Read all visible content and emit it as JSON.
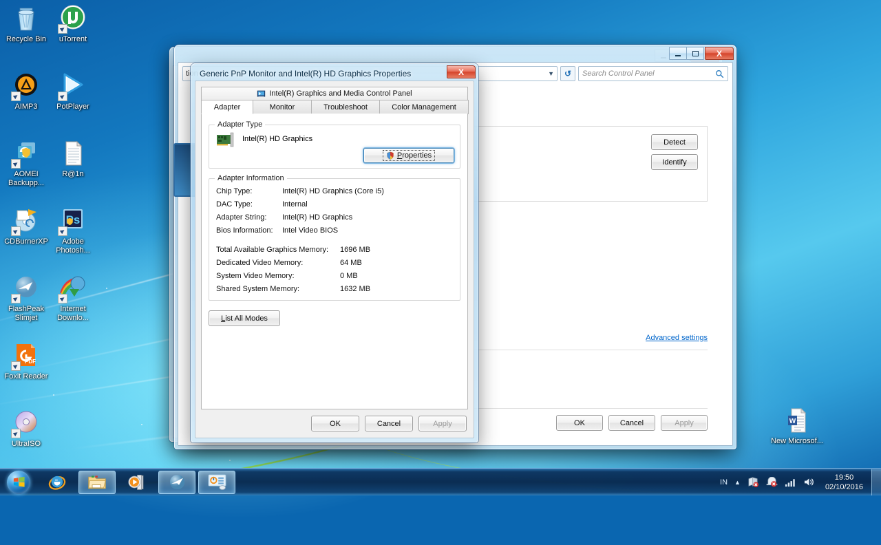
{
  "desktop": {
    "icons": [
      {
        "label": "Recycle Bin",
        "icon": "recycle-bin-icon",
        "shortcut": false
      },
      {
        "label": "uTorrent",
        "icon": "utorrent-icon",
        "shortcut": true
      },
      {
        "label": "AIMP3",
        "icon": "aimp3-icon",
        "shortcut": true
      },
      {
        "label": "PotPlayer",
        "icon": "potplayer-icon",
        "shortcut": true
      },
      {
        "label": "AOMEI Backupp...",
        "icon": "aomei-backupper-icon",
        "shortcut": true
      },
      {
        "label": "R@1n",
        "icon": "text-document-icon",
        "shortcut": false
      },
      {
        "label": "CDBurnerXP",
        "icon": "cdburnerxp-icon",
        "shortcut": true
      },
      {
        "label": "Adobe Photosh...",
        "icon": "adobe-photoshop-icon",
        "shortcut": true
      },
      {
        "label": "FlashPeak Slimjet",
        "icon": "slimjet-icon",
        "shortcut": true
      },
      {
        "label": "Internet Downlo...",
        "icon": "internet-download-manager-icon",
        "shortcut": true
      },
      {
        "label": "Foxit Reader",
        "icon": "foxit-reader-icon",
        "shortcut": true
      },
      {
        "label": "UltraISO",
        "icon": "ultraiso-icon",
        "shortcut": true
      },
      {
        "label": "New Microsof...",
        "icon": "word-document-icon",
        "shortcut": false
      }
    ]
  },
  "control_panel_window": {
    "title": "",
    "address_value": "tion",
    "search_placeholder": "Search Control Panel",
    "search_icon": "search-icon",
    "refresh_icon": "refresh-icon",
    "dropdown_icon": "chevron-down-icon",
    "minimize_label": "–",
    "maximize_label": "□",
    "close_label": "X",
    "detect_label": "Detect",
    "identify_label": "Identify",
    "advanced_settings_label": "Advanced settings",
    "ok_label": "OK",
    "cancel_label": "Cancel",
    "apply_label": "Apply"
  },
  "back_window": {
    "minimize_label": "–",
    "maximize_label": "□",
    "close_label": "X"
  },
  "dialog": {
    "title": "Generic PnP Monitor and Intel(R) HD Graphics Properties",
    "close_label": "X",
    "banner": {
      "icon": "intel-graphics-icon",
      "label": "Intel(R) Graphics and Media Control Panel"
    },
    "tabs": [
      {
        "label": "Adapter",
        "active": true
      },
      {
        "label": "Monitor",
        "active": false
      },
      {
        "label": "Troubleshoot",
        "active": false
      },
      {
        "label": "Color Management",
        "active": false
      }
    ],
    "adapter_type": {
      "legend": "Adapter Type",
      "icon": "graphics-card-icon",
      "value": "Intel(R) HD Graphics",
      "properties_button": {
        "label": "Properties",
        "underline_char": "P",
        "icon": "uac-shield-icon",
        "focused": true
      }
    },
    "adapter_information": {
      "legend": "Adapter Information",
      "rows": [
        {
          "key": "Chip Type:",
          "value": "Intel(R) HD Graphics (Core i5)"
        },
        {
          "key": "DAC Type:",
          "value": "Internal"
        },
        {
          "key": "Adapter String:",
          "value": "Intel(R) HD Graphics"
        },
        {
          "key": "Bios Information:",
          "value": "Intel Video BIOS"
        }
      ],
      "memory_rows": [
        {
          "key": "Total Available Graphics Memory:",
          "value": "1696 MB"
        },
        {
          "key": "Dedicated Video Memory:",
          "value": "64 MB"
        },
        {
          "key": "System Video Memory:",
          "value": "0 MB"
        },
        {
          "key": "Shared System Memory:",
          "value": "1632 MB"
        }
      ]
    },
    "list_all_modes_label": "List All Modes",
    "footer": {
      "ok_label": "OK",
      "cancel_label": "Cancel",
      "apply_label": "Apply",
      "apply_disabled": true
    }
  },
  "taskbar": {
    "start_icon": "windows-start-orb-icon",
    "buttons": [
      {
        "name": "internet-explorer",
        "icon": "internet-explorer-icon",
        "active": false,
        "pinned": true
      },
      {
        "name": "windows-explorer",
        "icon": "folder-explorer-icon",
        "active": true,
        "pinned": true
      },
      {
        "name": "media-player",
        "icon": "windows-media-player-icon",
        "active": false,
        "pinned": true
      },
      {
        "name": "slimjet-browser",
        "icon": "slimjet-icon",
        "active": true,
        "pinned": false
      },
      {
        "name": "control-panel",
        "icon": "control-panel-icon",
        "active": true,
        "pinned": false
      }
    ],
    "tray": {
      "language": "IN",
      "show_hidden_icons": "chevron-up-icon",
      "icons": [
        {
          "name": "network-error-icon"
        },
        {
          "name": "action-center-error-icon"
        },
        {
          "name": "signal-bars-icon"
        },
        {
          "name": "volume-icon"
        }
      ],
      "time": "19:50",
      "date": "02/10/2016"
    },
    "show_desktop": "show-desktop-button"
  }
}
